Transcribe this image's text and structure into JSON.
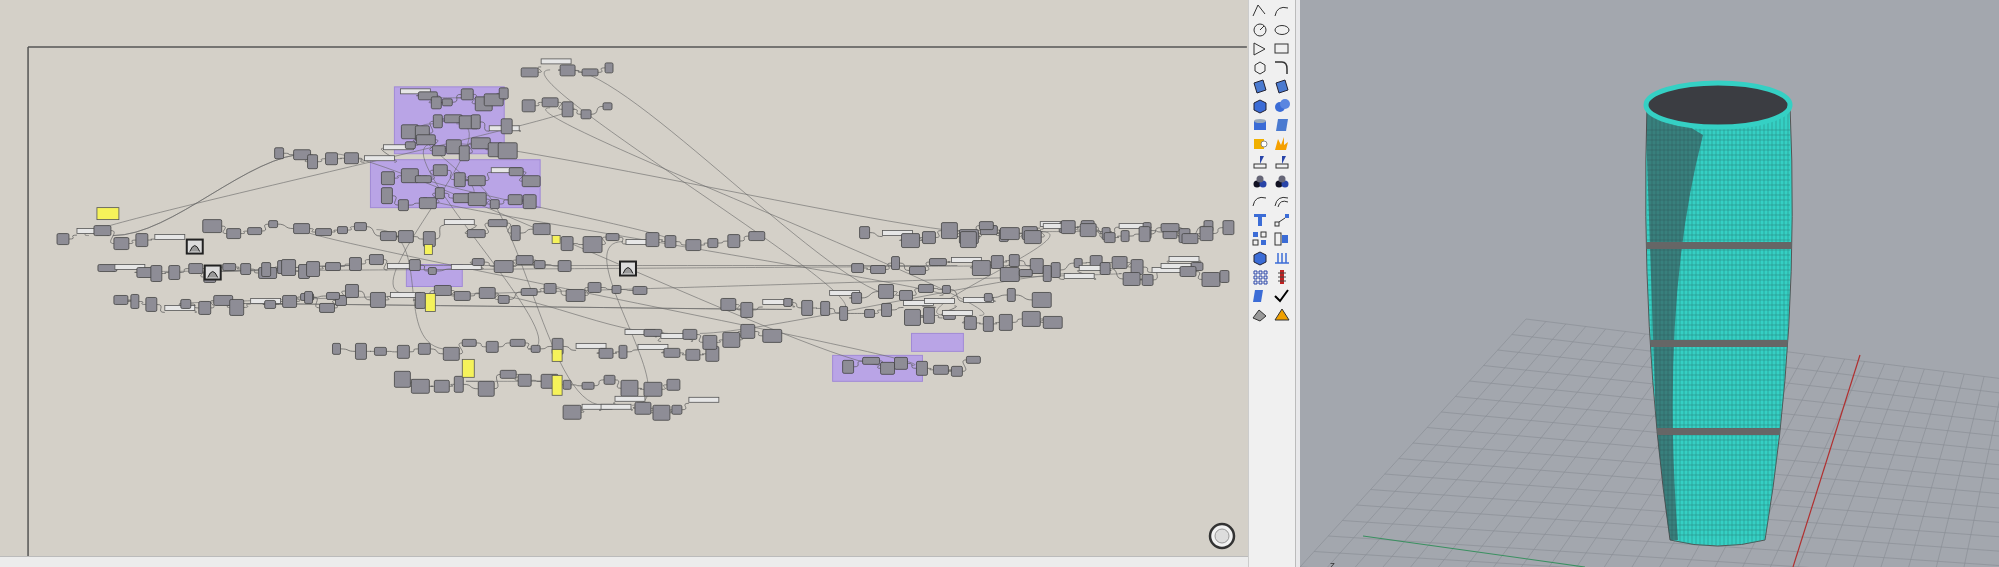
{
  "viewport": {
    "axis_label": "z"
  }
}
